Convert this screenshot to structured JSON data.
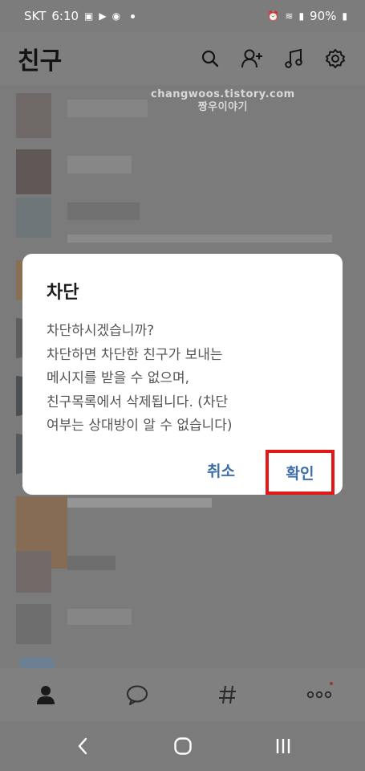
{
  "status_bar": {
    "carrier": "SKT",
    "time": "6:10",
    "battery": "90%"
  },
  "app_header": {
    "title": "친구",
    "icons": [
      "search-icon",
      "add-friend-icon",
      "music-icon",
      "settings-icon"
    ]
  },
  "watermark": {
    "line1": "changwoos.tistory.com",
    "line2": "짱우이야기"
  },
  "dialog": {
    "title": "차단",
    "message": "차단하시겠습니까?\n차단하면 차단한 친구가 보내는\n메시지를 받을 수 없으며,\n친구목록에서 삭제됩니다. (차단\n여부는 상대방이 알 수 없습니다)",
    "cancel_label": "취소",
    "confirm_label": "확인",
    "highlight_color": "#e01818",
    "button_color": "#3f6fa8"
  },
  "bottom_nav": {
    "items": [
      "friends-icon",
      "chat-icon",
      "hashtag-icon",
      "more-icon"
    ]
  },
  "system_nav": {
    "items": [
      "back-icon",
      "home-icon",
      "recents-icon"
    ]
  }
}
